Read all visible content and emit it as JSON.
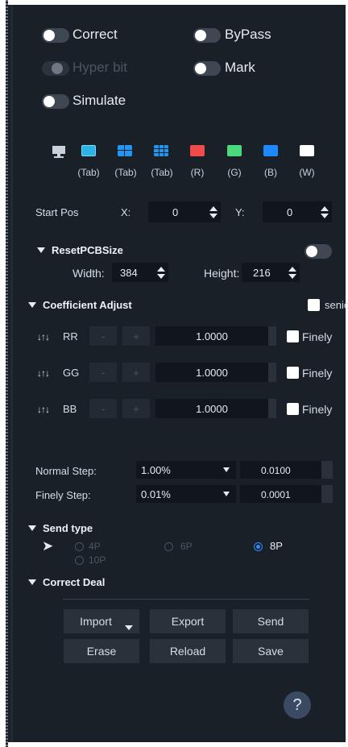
{
  "toggles": {
    "correct": "Correct",
    "bypass": "ByPass",
    "hyperbit": "Hyper bit",
    "mark": "Mark",
    "simulate": "Simulate"
  },
  "test_patterns": [
    {
      "name": "monitor-icon",
      "label": "",
      "color": "#c9d0da"
    },
    {
      "name": "image-icon",
      "label": "(Tab)",
      "color": "#2bb3e8"
    },
    {
      "name": "grid-icon",
      "label": "(Tab)",
      "color": "#2196f3"
    },
    {
      "name": "grid-fine-icon",
      "label": "(Tab)",
      "color": "#2196f3"
    },
    {
      "name": "red-swatch",
      "label": "(R)",
      "color": "#ef4b4b"
    },
    {
      "name": "green-swatch",
      "label": "(G)",
      "color": "#4cd97b"
    },
    {
      "name": "blue-swatch",
      "label": "(B)",
      "color": "#1e88ff"
    },
    {
      "name": "white-swatch",
      "label": "(W)",
      "color": "#ffffff"
    }
  ],
  "start_pos": {
    "label": "Start Pos",
    "x_label": "X:",
    "x_value": "0",
    "y_label": "Y:",
    "y_value": "0"
  },
  "reset_pcb": {
    "title": "ResetPCBSize",
    "width_label": "Width:",
    "width_value": "384",
    "height_label": "Height:",
    "height_value": "216"
  },
  "coefficient": {
    "title": "Coefficient Adjust",
    "senior_label": "senior",
    "rows": [
      {
        "name": "RR",
        "minus": "-",
        "plus": "+",
        "value": "1.0000",
        "finely": "Finely"
      },
      {
        "name": "GG",
        "minus": "-",
        "plus": "+",
        "value": "1.0000",
        "finely": "Finely"
      },
      {
        "name": "BB",
        "minus": "-",
        "plus": "+",
        "value": "1.0000",
        "finely": "Finely"
      }
    ]
  },
  "steps": {
    "normal_label": "Normal Step:",
    "normal_select": "1.00%",
    "normal_value": "0.0100",
    "finely_label": "Finely Step:",
    "finely_select": "0.01%",
    "finely_value": "0.0001"
  },
  "send_type": {
    "title": "Send type",
    "options": [
      "4P",
      "6P",
      "8P",
      "10P"
    ],
    "selected": "8P"
  },
  "correct_deal": {
    "title": "Correct Deal",
    "buttons": [
      "Import",
      "Export",
      "Send",
      "Erase",
      "Reload",
      "Save"
    ]
  },
  "help": "?"
}
